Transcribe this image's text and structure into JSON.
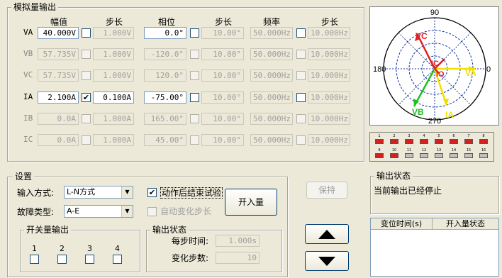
{
  "analog_output": {
    "title": "模拟量输出",
    "headers": [
      "幅值",
      "步长",
      "相位",
      "步长",
      "频率",
      "步长"
    ],
    "rows": [
      {
        "label": "VA",
        "amp": "40.000V",
        "amp_step": "1.000V",
        "phase": "0.0°",
        "phase_step": "10.00°",
        "freq": "50.000Hz",
        "freq_step": "10.000Hz",
        "amp_step_checked": "",
        "enabled": true
      },
      {
        "label": "VB",
        "amp": "57.735V",
        "amp_step": "1.000V",
        "phase": "-120.0°",
        "phase_step": "10.00°",
        "freq": "50.000Hz",
        "freq_step": "10.000Hz",
        "amp_step_checked": "",
        "enabled": false
      },
      {
        "label": "VC",
        "amp": "57.735V",
        "amp_step": "1.000V",
        "phase": "120.0°",
        "phase_step": "10.00°",
        "freq": "50.000Hz",
        "freq_step": "10.000Hz",
        "amp_step_checked": "",
        "enabled": false
      },
      {
        "label": "IA",
        "amp": "2.100A",
        "amp_step": "0.100A",
        "phase": "-75.00°",
        "phase_step": "10.00°",
        "freq": "50.000Hz",
        "freq_step": "10.000Hz",
        "amp_step_checked": "✔",
        "enabled": true
      },
      {
        "label": "IB",
        "amp": "0.0A",
        "amp_step": "1.000A",
        "phase": "165.00°",
        "phase_step": "10.00°",
        "freq": "50.000Hz",
        "freq_step": "10.000Hz",
        "amp_step_checked": "",
        "enabled": false
      },
      {
        "label": "IC",
        "amp": "0.0A",
        "amp_step": "1.000A",
        "phase": "45.00°",
        "phase_step": "10.00°",
        "freq": "50.000Hz",
        "freq_step": "10.000Hz",
        "amp_step_checked": "",
        "enabled": false
      }
    ]
  },
  "phasor": {
    "labels": {
      "top": "90",
      "left": "180",
      "right": "0",
      "bottom": "270"
    },
    "vectors": [
      {
        "name": "VC",
        "color": "#e02020"
      },
      {
        "name": "VA",
        "color": "#f0e000"
      },
      {
        "name": "IC",
        "color": "#e02020"
      },
      {
        "name": "IO",
        "color": "#e02020"
      },
      {
        "name": "VB",
        "color": "#20c020"
      },
      {
        "name": "IA",
        "color": "#f0e000"
      }
    ],
    "axis_color": "#1030a0"
  },
  "indicators": {
    "row1": [
      "1",
      "2",
      "3",
      "4",
      "5",
      "6",
      "7",
      "8"
    ],
    "row2": [
      "9",
      "10",
      "11",
      "12",
      "13",
      "14",
      "15",
      "16"
    ],
    "on_color": "#d62020",
    "off_color": "#c0c0c0"
  },
  "settings": {
    "title": "设置",
    "input_mode_label": "输入方式:",
    "input_mode_value": "L-N方式",
    "fault_type_label": "故障类型:",
    "fault_type_value": "A-E",
    "action_end_label": "动作后结束试验",
    "action_end_checked": "✔",
    "auto_step_label": "自动变化步长",
    "binary_input_button": "开入量",
    "switch_output": {
      "title": "开关量输出",
      "items": [
        "1",
        "2",
        "3",
        "4"
      ]
    },
    "output_status": {
      "title": "输出状态",
      "step_time_label": "每步时间:",
      "step_time_value": "1.000s",
      "step_count_label": "变化步数:",
      "step_count_value": "10"
    }
  },
  "hold_button": "保持",
  "output_state": {
    "title": "输出状态",
    "text": "当前输出已经停止"
  },
  "table": {
    "headers": [
      "变位时间(s)",
      "开入量状态"
    ]
  }
}
